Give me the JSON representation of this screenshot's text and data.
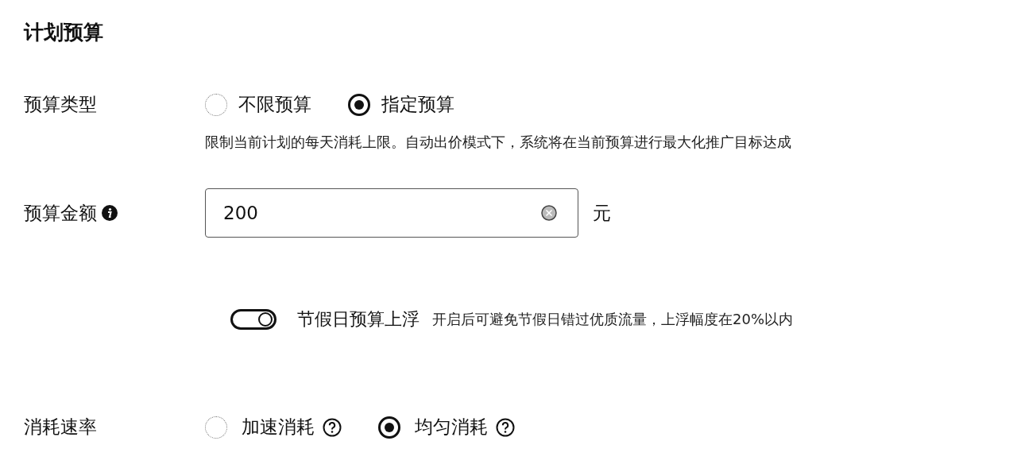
{
  "title": "计划预算",
  "budget_type": {
    "label": "预算类型",
    "options": [
      {
        "label": "不限预算",
        "selected": false
      },
      {
        "label": "指定预算",
        "selected": true
      }
    ],
    "hint": "限制当前计划的每天消耗上限。自动出价模式下，系统将在当前预算进行最大化推广目标达成"
  },
  "budget_amount": {
    "label": "预算金额",
    "value": "200",
    "unit": "元"
  },
  "holiday": {
    "on": true,
    "label": "节假日预算上浮",
    "hint": "开启后可避免节假日错过优质流量，上浮幅度在20%以内"
  },
  "spend_rate": {
    "label": "消耗速率",
    "options": [
      {
        "label": "加速消耗",
        "selected": false
      },
      {
        "label": "均匀消耗",
        "selected": true
      }
    ]
  }
}
